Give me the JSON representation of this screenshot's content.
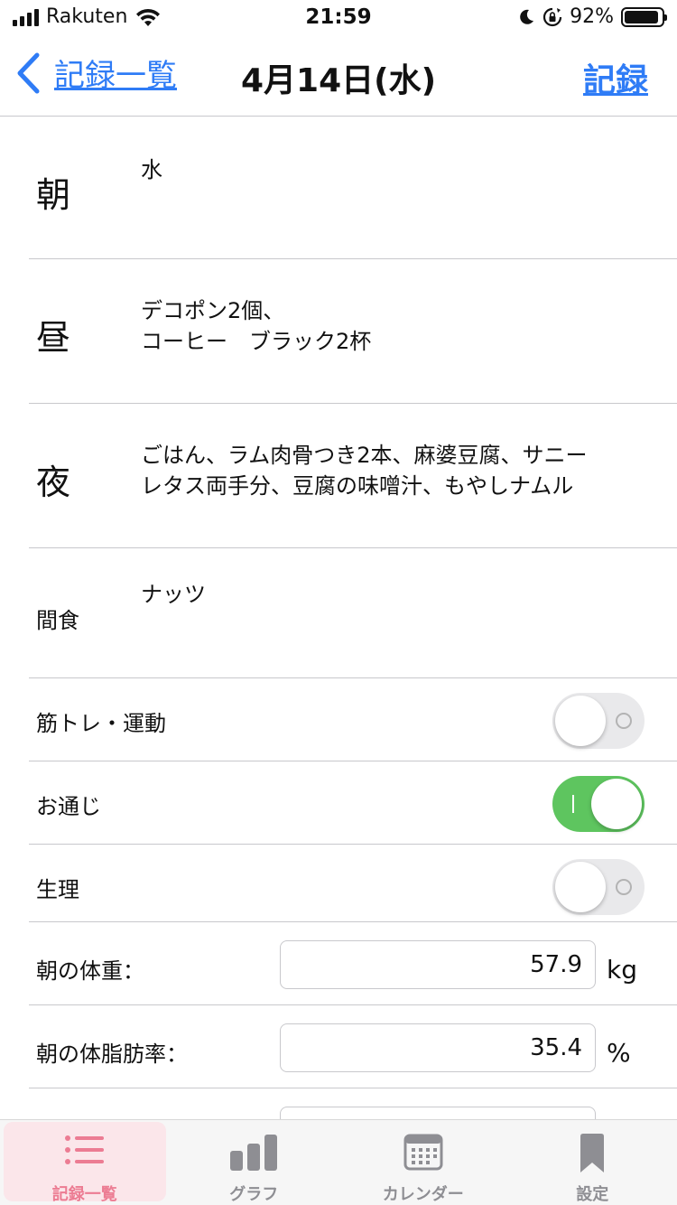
{
  "status_bar": {
    "carrier": "Rakuten",
    "time": "21:59",
    "battery_text": "92%",
    "battery_level": 0.92
  },
  "nav": {
    "back_label": "記録一覧",
    "title": "4月14日(水)",
    "record_label": "記録"
  },
  "meals": [
    {
      "label": "朝",
      "lines": [
        "水"
      ]
    },
    {
      "label": "昼",
      "lines": [
        "デコポン2個、",
        "コーヒー　ブラック2杯"
      ]
    },
    {
      "label": "夜",
      "lines": [
        "ごはん、ラム肉骨つき2本、麻婆豆腐、サニー",
        "レタス両手分、豆腐の味噌汁、もやしナムル"
      ]
    },
    {
      "label": "間食",
      "lines": [
        "ナッツ"
      ]
    }
  ],
  "toggles": [
    {
      "label": "筋トレ・運動",
      "on": false
    },
    {
      "label": "お通じ",
      "on": true
    },
    {
      "label": "生理",
      "on": false
    }
  ],
  "measurements": [
    {
      "label": "朝の体重：",
      "value": "57.9",
      "unit": "kg"
    },
    {
      "label": "朝の体脂肪率：",
      "value": "35.4",
      "unit": "%"
    }
  ],
  "tabs": [
    {
      "label": "記録一覧",
      "icon": "list-icon",
      "active": true
    },
    {
      "label": "グラフ",
      "icon": "bar-chart-icon",
      "active": false
    },
    {
      "label": "カレンダー",
      "icon": "calendar-icon",
      "active": false
    },
    {
      "label": "設定",
      "icon": "bookmark-icon",
      "active": false
    }
  ],
  "colors": {
    "accent": "#2f7cf6",
    "toggle_on": "#5ec55f",
    "tab_active": "#ec7c93",
    "tab_inactive": "#8e8e93"
  }
}
